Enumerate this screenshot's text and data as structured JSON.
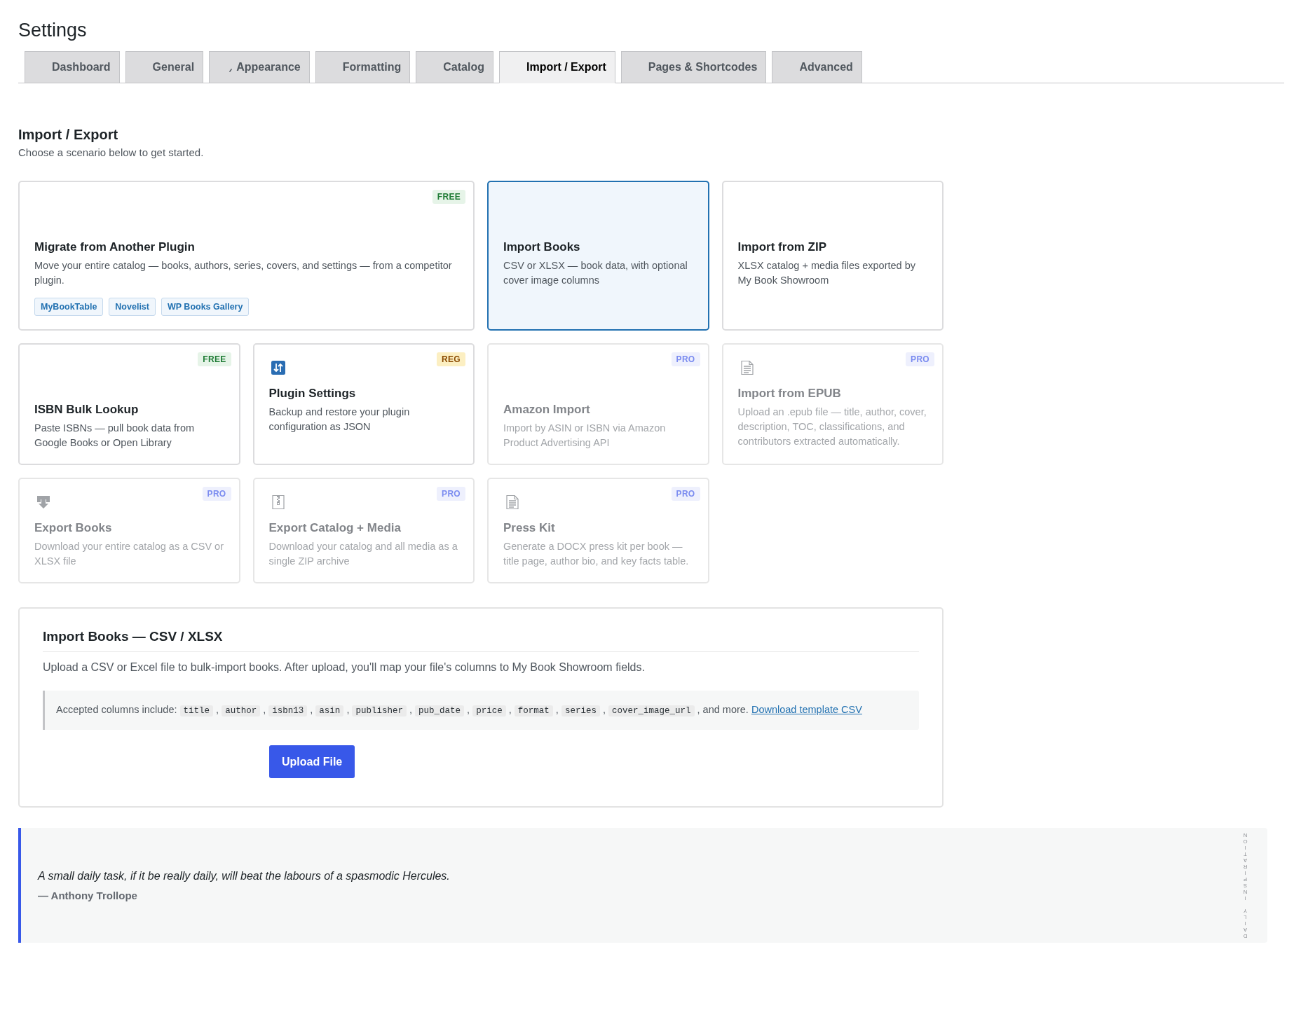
{
  "page": {
    "title": "Settings"
  },
  "tabs": [
    {
      "label": "Dashboard",
      "selected": false,
      "kind": "plain"
    },
    {
      "label": "General",
      "selected": false,
      "kind": "plain"
    },
    {
      "label": "Appearance",
      "selected": false,
      "kind": "marked"
    },
    {
      "label": "Formatting",
      "selected": false,
      "kind": "plain"
    },
    {
      "label": "Catalog",
      "selected": false,
      "kind": "plain"
    },
    {
      "label": "Import / Export",
      "selected": true,
      "kind": "plain"
    },
    {
      "label": "Pages & Shortcodes",
      "selected": false,
      "kind": "plain"
    },
    {
      "label": "Advanced",
      "selected": false,
      "kind": "plain"
    }
  ],
  "section": {
    "title": "Import / Export",
    "subtitle": "Choose a scenario below to get started."
  },
  "scenarios": [
    {
      "kind": "plain",
      "title": "Migrate from Another Plugin",
      "description": "Move your entire catalog — books, authors, series, covers, and settings — from a competitor plugin.",
      "badge": {
        "label": "FREE",
        "kind": "free"
      },
      "selected": false,
      "disabled": false,
      "tags": [
        "MyBookTable",
        "Novelist",
        "WP Books Gallery"
      ]
    },
    {
      "kind": "plain",
      "title": "Import Books",
      "description": "CSV or XLSX — book data, with optional cover image columns",
      "selected": true,
      "disabled": false
    },
    {
      "kind": "plain",
      "title": "Import from ZIP",
      "description": "XLSX catalog + media files exported by My Book Showroom",
      "selected": false,
      "disabled": false
    },
    {
      "kind": "plain",
      "title": "ISBN Bulk Lookup",
      "description": "Paste ISBNs — pull book data from Google Books or Open Library",
      "badge": {
        "label": "FREE",
        "kind": "free"
      },
      "selected": false,
      "disabled": false
    },
    {
      "kind": "arrows",
      "title": "Plugin Settings",
      "description": "Backup and restore your plugin configuration as JSON",
      "badge": {
        "label": "REG",
        "kind": "reg"
      },
      "selected": false,
      "disabled": false
    },
    {
      "kind": "plain",
      "title": "Amazon Import",
      "description": "Import by ASIN or ISBN via Amazon Product Advertising API",
      "badge": {
        "label": "PRO",
        "kind": "pro"
      },
      "selected": false,
      "disabled": true
    },
    {
      "kind": "document",
      "title": "Import from EPUB",
      "description": "Upload an .epub file — title, author, cover, description, TOC, classifications, and contributors extracted automatically.",
      "badge": {
        "label": "PRO",
        "kind": "pro"
      },
      "selected": false,
      "disabled": true
    },
    {
      "kind": "download",
      "title": "Export Books",
      "description": "Download your entire catalog as a CSV or XLSX file",
      "badge": {
        "label": "PRO",
        "kind": "pro"
      },
      "selected": false,
      "disabled": true
    },
    {
      "kind": "archive",
      "title": "Export Catalog + Media",
      "description": "Download your catalog and all media as a single ZIP archive",
      "badge": {
        "label": "PRO",
        "kind": "pro"
      },
      "selected": false,
      "disabled": true
    },
    {
      "kind": "document",
      "title": "Press Kit",
      "description": "Generate a DOCX press kit per book — title page, author bio, and key facts table.",
      "badge": {
        "label": "PRO",
        "kind": "pro"
      },
      "selected": false,
      "disabled": true
    }
  ],
  "import_panel": {
    "title": "Import Books — CSV / XLSX",
    "description": "Upload a CSV or Excel file to bulk-import books. After upload, you'll map your file's columns to My Book Showroom fields.",
    "notice": {
      "lead": "Accepted columns include:",
      "columns": [
        "title",
        "author",
        "isbn13",
        "asin",
        "publisher",
        "pub_date",
        "price",
        "format",
        "series",
        "cover_image_url"
      ],
      "separator": ",",
      "tail": ", and more.",
      "link": "Download template CSV"
    },
    "button": "Upload File"
  },
  "quote": {
    "text": "A small daily task, if it be really daily, will beat the labours of a spasmodic Hercules.",
    "author": "— Anthony Trollope",
    "label": "DAILY INSPIRATION"
  }
}
